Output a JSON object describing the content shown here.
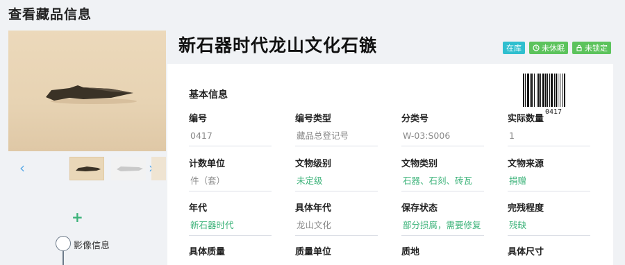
{
  "page": {
    "title": "查看藏品信息"
  },
  "artifact": {
    "title": "新石器时代龙山文化石镞",
    "badges": [
      {
        "label": "在库",
        "icon": ""
      },
      {
        "label": "未休眠",
        "icon": "clock-icon"
      },
      {
        "label": "未锁定",
        "icon": "lock-icon"
      }
    ],
    "barcode": "0417"
  },
  "media": {
    "prev_label": "‹",
    "next_label": "›",
    "add_symbol": "+",
    "timeline_label": "影像信息"
  },
  "basic_info": {
    "section_title": "基本信息",
    "fields": [
      {
        "label": "编号",
        "value": "0417"
      },
      {
        "label": "编号类型",
        "value": "藏品总登记号"
      },
      {
        "label": "分类号",
        "value": "W-03:S006"
      },
      {
        "label": "实际数量",
        "value": "1"
      },
      {
        "label": "计数单位",
        "value": "件（套）"
      },
      {
        "label": "文物级别",
        "value": "未定级"
      },
      {
        "label": "文物类别",
        "value": "石器、石刻、砖瓦"
      },
      {
        "label": "文物来源",
        "value": "捐赠"
      },
      {
        "label": "年代",
        "value": "新石器时代"
      },
      {
        "label": "具体年代",
        "value": "龙山文化"
      },
      {
        "label": "保存状态",
        "value": "部分损腐，需要修复"
      },
      {
        "label": "完残程度",
        "value": "残缺"
      },
      {
        "label": "具体质量",
        "value": ""
      },
      {
        "label": "质量单位",
        "value": ""
      },
      {
        "label": "质地",
        "value": ""
      },
      {
        "label": "具体尺寸",
        "value": ""
      }
    ]
  },
  "colors": {
    "accent_green": "#3db37a",
    "badge_teal": "#2fbfcf",
    "badge_green": "#5cc35c",
    "link_blue": "#5aa9e6"
  }
}
